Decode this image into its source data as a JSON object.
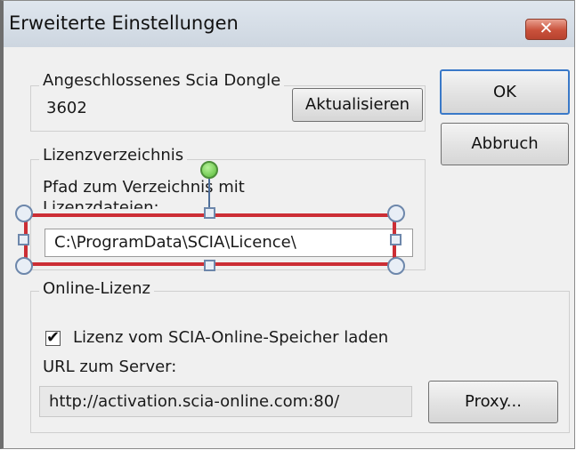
{
  "window": {
    "title": "Erweiterte Einstellungen",
    "close_glyph": "✕"
  },
  "dongle_group": {
    "legend": "Angeschlossenes Scia Dongle",
    "value": "3602",
    "refresh_label": "Aktualisieren"
  },
  "buttons": {
    "ok_label": "OK",
    "cancel_label": "Abbruch"
  },
  "license_group": {
    "legend": "Lizenzverzeichnis",
    "path_label_line1": "Pfad zum Verzeichnis mit",
    "path_label_line2": "Lizenzdateien:",
    "path_value": "C:\\ProgramData\\SCIA\\Licence\\"
  },
  "online_group": {
    "legend": "Online-Lizenz",
    "checkbox_label": "Lizenz vom SCIA-Online-Speicher laden",
    "checkbox_checked": true,
    "checkbox_glyph": "✔",
    "server_label": "URL zum Server:",
    "server_value": "http://activation.scia-online.com:80/",
    "proxy_label": "Proxy..."
  },
  "colors": {
    "selection_outline": "#cc2e35",
    "rotate_handle": "#55b935",
    "close_button": "#c9513b"
  },
  "icons": [
    "close-icon",
    "check-icon",
    "rotate-handle",
    "resize-handle"
  ]
}
